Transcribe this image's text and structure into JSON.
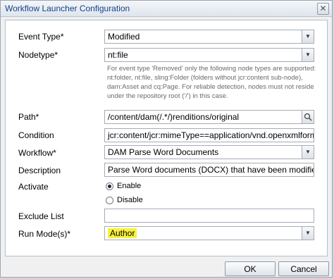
{
  "window": {
    "title": "Workflow Launcher Configuration",
    "close_glyph": "✕"
  },
  "form": {
    "event_type": {
      "label": "Event Type*",
      "value": "Modified"
    },
    "nodetype": {
      "label": "Nodetype*",
      "value": "nt:file",
      "hint": "For event type 'Removed' only the following node types are supported: nt:folder, nt:file, sling:Folder (folders without jcr:content sub-node), dam:Asset and cq:Page. For reliable detection, nodes must not reside under the repository root ('/') in this case."
    },
    "path": {
      "label": "Path*",
      "value": "/content/dam(/.*/)renditions/original"
    },
    "condition": {
      "label": "Condition",
      "value": "jcr:content/jcr:mimeType==application/vnd.openxmlforma"
    },
    "workflow": {
      "label": "Workflow*",
      "value": "DAM Parse Word Documents"
    },
    "description": {
      "label": "Description",
      "value": "Parse Word documents (DOCX) that have been modified ir"
    },
    "activate": {
      "label": "Activate",
      "options": [
        "Enable",
        "Disable"
      ],
      "selected": "Enable"
    },
    "exclude_list": {
      "label": "Exclude List",
      "value": ""
    },
    "run_modes": {
      "label": "Run Mode(s)*",
      "value": "Author",
      "highlight_color": "#f7f23a"
    }
  },
  "buttons": {
    "ok": "OK",
    "cancel": "Cancel"
  },
  "icons": {
    "search": "search-icon",
    "dropdown": "chevron-down-icon"
  }
}
